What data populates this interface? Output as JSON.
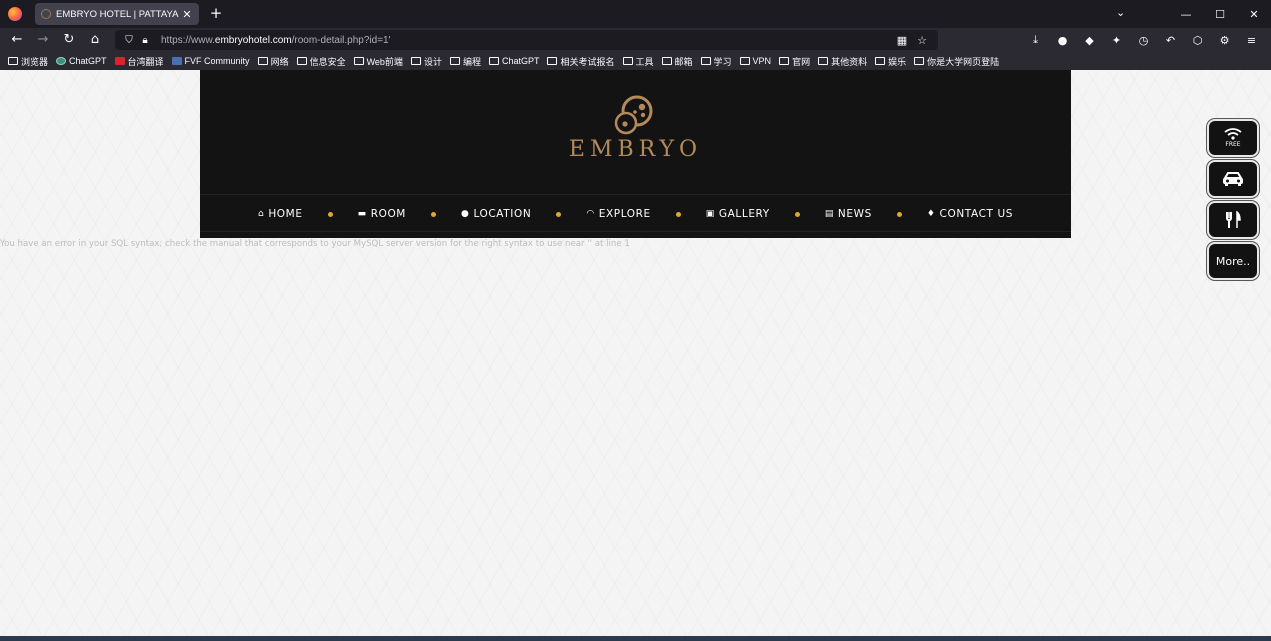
{
  "browser": {
    "tab_title": "EMBRYO HOTEL | PATTAYA",
    "tab_close": "✕",
    "new_tab": "+",
    "url_prefix": "https://www.",
    "url_domain": "embryohotel.com",
    "url_path": "/room-detail.php?id=1'",
    "window_controls": [
      "⌄",
      "—",
      "☐",
      "✕"
    ],
    "bookmarks": [
      {
        "label": "浏览器",
        "icon": "folder"
      },
      {
        "label": "ChatGPT",
        "icon": "chatgpt"
      },
      {
        "label": "台湾翻译",
        "icon": "red"
      },
      {
        "label": "FVF Community",
        "icon": "blue"
      },
      {
        "label": "网络",
        "icon": "folder"
      },
      {
        "label": "信息安全",
        "icon": "folder"
      },
      {
        "label": "Web前端",
        "icon": "folder"
      },
      {
        "label": "设计",
        "icon": "folder"
      },
      {
        "label": "编程",
        "icon": "folder"
      },
      {
        "label": "ChatGPT",
        "icon": "folder"
      },
      {
        "label": "相关考试报名",
        "icon": "folder"
      },
      {
        "label": "工具",
        "icon": "folder"
      },
      {
        "label": "邮箱",
        "icon": "folder"
      },
      {
        "label": "学习",
        "icon": "folder"
      },
      {
        "label": "VPN",
        "icon": "folder"
      },
      {
        "label": "官网",
        "icon": "folder"
      },
      {
        "label": "其他资料",
        "icon": "folder"
      },
      {
        "label": "娱乐",
        "icon": "folder"
      },
      {
        "label": "你是大学网页登陆",
        "icon": "folder"
      }
    ]
  },
  "site": {
    "logo_text": "EMBRYO",
    "menu": [
      {
        "label": "HOME",
        "icon": "home-icon",
        "glyph": "⌂"
      },
      {
        "label": "ROOM",
        "icon": "bed-icon",
        "glyph": "▬"
      },
      {
        "label": "LOCATION",
        "icon": "globe-icon",
        "glyph": "●"
      },
      {
        "label": "EXPLORE",
        "icon": "wifi-icon",
        "glyph": "◠"
      },
      {
        "label": "GALLERY",
        "icon": "image-icon",
        "glyph": "▣"
      },
      {
        "label": "NEWS",
        "icon": "newspaper-icon",
        "glyph": "▤"
      },
      {
        "label": "CONTACT US",
        "icon": "map-marker-icon",
        "glyph": "♦"
      }
    ],
    "error_message": "You have an error in your SQL syntax; check the manual that corresponds to your MySQL server version for the right syntax to use near '' at line 1",
    "float_buttons": {
      "wifi_sub": "FREE",
      "more": "More.."
    },
    "accent_color": "#e0a828",
    "gold_color": "#b48a5a"
  }
}
